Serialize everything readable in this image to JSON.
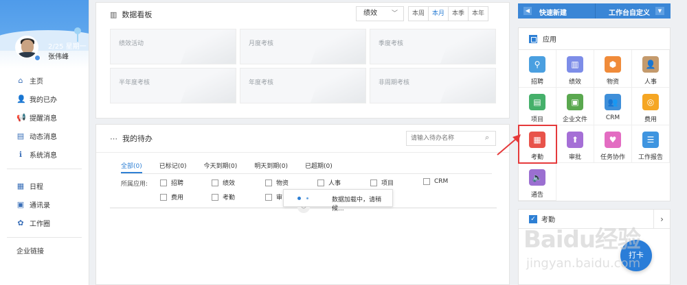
{
  "profile": {
    "date": "2/25 星期一",
    "name": "张伟峰"
  },
  "nav": {
    "items": [
      {
        "label": "主页",
        "icon": "home-icon",
        "glyph": "⌂"
      },
      {
        "label": "我的已办",
        "icon": "user-check-icon",
        "glyph": "👤"
      },
      {
        "label": "提醒消息",
        "icon": "megaphone-icon",
        "glyph": "📢"
      },
      {
        "label": "动态消息",
        "icon": "chat-icon",
        "glyph": "▤"
      },
      {
        "label": "系统消息",
        "icon": "info-icon",
        "glyph": "ℹ"
      }
    ],
    "items2": [
      {
        "label": "日程",
        "icon": "calendar-icon",
        "glyph": "▦"
      },
      {
        "label": "通讯录",
        "icon": "contacts-icon",
        "glyph": "▣"
      },
      {
        "label": "工作圈",
        "icon": "circle-icon",
        "glyph": "✿"
      }
    ],
    "enterprise_link": "企业链接"
  },
  "dashboard": {
    "title": "数据看板",
    "select_value": "绩效",
    "ranges": [
      "本周",
      "本月",
      "本季",
      "本年"
    ],
    "active_range": "本月",
    "cards": [
      "绩效活动",
      "月度考核",
      "季度考核",
      "半年度考核",
      "年度考核",
      "非周期考核"
    ]
  },
  "todo": {
    "title": "我的待办",
    "search_placeholder": "请输入待办名称",
    "tabs": [
      "全部(0)",
      "已标记(0)",
      "今天到期(0)",
      "明天到期(0)",
      "已超期(0)"
    ],
    "filter_label": "所属应用:",
    "filters_row1": [
      "招聘",
      "绩效",
      "物资",
      "人事",
      "项目",
      "CRM"
    ],
    "filters_row2": [
      "费用",
      "考勤",
      "审"
    ],
    "loading_text": "数据加载中，请稍候..."
  },
  "quick": {
    "left": "快速新建",
    "right": "工作台自定义"
  },
  "apps": {
    "title": "应用",
    "items": [
      {
        "label": "招聘",
        "color": "#4a9fe0",
        "glyph": "⚲",
        "icon": "recruit-icon"
      },
      {
        "label": "绩效",
        "color": "#7d8de8",
        "glyph": "▥",
        "icon": "performance-icon"
      },
      {
        "label": "物资",
        "color": "#f08b3a",
        "glyph": "⬢",
        "icon": "materials-icon"
      },
      {
        "label": "人事",
        "color": "#c49a6c",
        "glyph": "👤",
        "icon": "hr-icon"
      },
      {
        "label": "项目",
        "color": "#45b06a",
        "glyph": "▤",
        "icon": "project-icon"
      },
      {
        "label": "企业文件",
        "color": "#5aa84f",
        "glyph": "▣",
        "icon": "files-icon"
      },
      {
        "label": "CRM",
        "color": "#3f8fd9",
        "glyph": "👥",
        "icon": "crm-icon"
      },
      {
        "label": "费用",
        "color": "#f5a623",
        "glyph": "◎",
        "icon": "expense-icon"
      },
      {
        "label": "考勤",
        "color": "#e8534a",
        "glyph": "▦",
        "icon": "attendance-icon"
      },
      {
        "label": "审批",
        "color": "#a56fd6",
        "glyph": "⬆",
        "icon": "approval-icon"
      },
      {
        "label": "任务协作",
        "color": "#e36cc2",
        "glyph": "♥",
        "icon": "task-icon"
      },
      {
        "label": "工作报告",
        "color": "#3f95e0",
        "glyph": "☰",
        "icon": "report-icon"
      },
      {
        "label": "通告",
        "color": "#9b6fd1",
        "glyph": "🔈",
        "icon": "notice-icon"
      }
    ],
    "highlight": "考勤"
  },
  "attendance": {
    "title": "考勤",
    "punch": "打卡"
  },
  "watermark": {
    "text": "Baidu经验",
    "url": "jingyan.baidu.com"
  }
}
